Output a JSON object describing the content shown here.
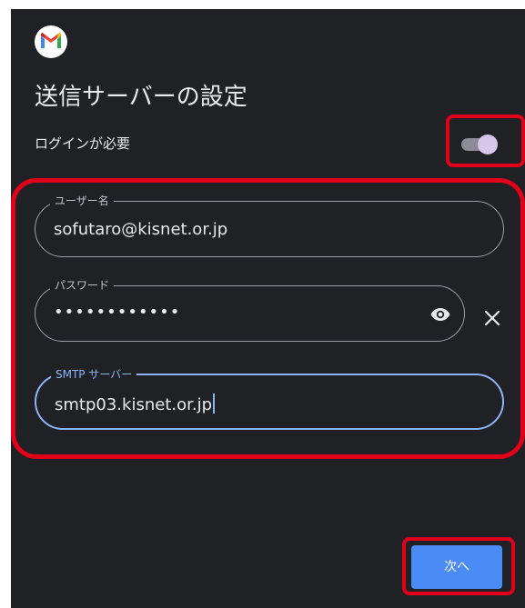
{
  "colors": {
    "background": "#202124",
    "text": "#e8eaed",
    "field_border": "#9aa0a6",
    "accent": "#8ab4f8",
    "button": "#4b8bf5",
    "highlight": "#e0001a",
    "toggle_thumb": "#d7c6ea"
  },
  "app": {
    "logo_icon": "gmail-logo-icon"
  },
  "page": {
    "title": "送信サーバーの設定"
  },
  "login": {
    "label": "ログインが必要",
    "toggle_on": true
  },
  "form": {
    "username": {
      "label": "ユーザー名",
      "value": "sofutaro@kisnet.or.jp"
    },
    "password": {
      "label": "パスワード",
      "value": "••••••••••••",
      "visibility_icon": "eye-icon",
      "clear_icon": "close-icon"
    },
    "smtp": {
      "label": "SMTP サーバー",
      "value": "smtp03.kisnet.or.jp"
    }
  },
  "actions": {
    "next_label": "次へ"
  }
}
